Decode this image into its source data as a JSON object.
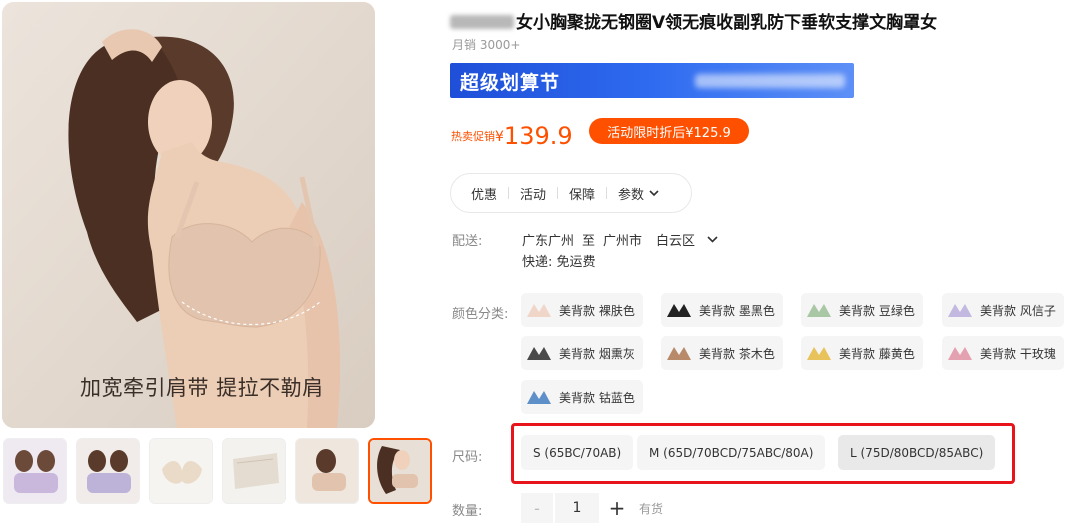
{
  "gallery": {
    "caption": "加宽牵引肩带 提拉不勒肩",
    "thumbs": [
      {
        "text": ""
      },
      {
        "text": ""
      },
      {
        "text": ""
      },
      {
        "text": ""
      },
      {
        "text": ""
      },
      {
        "text": ""
      }
    ]
  },
  "product": {
    "title": "女小胸聚拢无钢圈V领无痕收副乳防下垂软支撑文胸罩女",
    "sales": "月销 3000+",
    "banner_title": "超级划算节",
    "price_label": "热卖促销",
    "currency": "¥",
    "price": "139.9",
    "promo_badge": "活动限时折后¥125.9"
  },
  "tabs": [
    {
      "label": "优惠"
    },
    {
      "label": "活动"
    },
    {
      "label": "保障"
    },
    {
      "label": "参数"
    }
  ],
  "shipping": {
    "label": "配送:",
    "province": "广东广州",
    "to": "至",
    "city": "广州市",
    "district": "白云区",
    "method": "快递: 免运费"
  },
  "colors": {
    "label": "颜色分类:",
    "options": [
      {
        "label": "美背款 裸肤色",
        "color": "#f0d6c8"
      },
      {
        "label": "美背款 墨黑色",
        "color": "#222222"
      },
      {
        "label": "美背款 豆绿色",
        "color": "#a9c7a4"
      },
      {
        "label": "美背款 风信子",
        "color": "#c2b8e0"
      },
      {
        "label": "美背款 烟熏灰",
        "color": "#4a4a4a"
      },
      {
        "label": "美背款 茶木色",
        "color": "#b88a6a"
      },
      {
        "label": "美背款 藤黄色",
        "color": "#e8c25a"
      },
      {
        "label": "美背款 干玫瑰",
        "color": "#e4a2b0"
      },
      {
        "label": "美背款 钴蓝色",
        "color": "#5d8fc8"
      }
    ]
  },
  "sizes": {
    "label": "尺码:",
    "options": [
      {
        "label": "S (65BC/70AB)"
      },
      {
        "label": "M (65D/70BCD/75ABC/80A)"
      },
      {
        "label": "L (75D/80BCD/85ABC)"
      }
    ],
    "selected": "L (75D/80BCD/85ABC)"
  },
  "quantity": {
    "label": "数量:",
    "minus": "-",
    "value": "1",
    "plus": "+",
    "stock": "有货"
  },
  "accent": "#ff5000",
  "highlight_border": "#e8141b"
}
